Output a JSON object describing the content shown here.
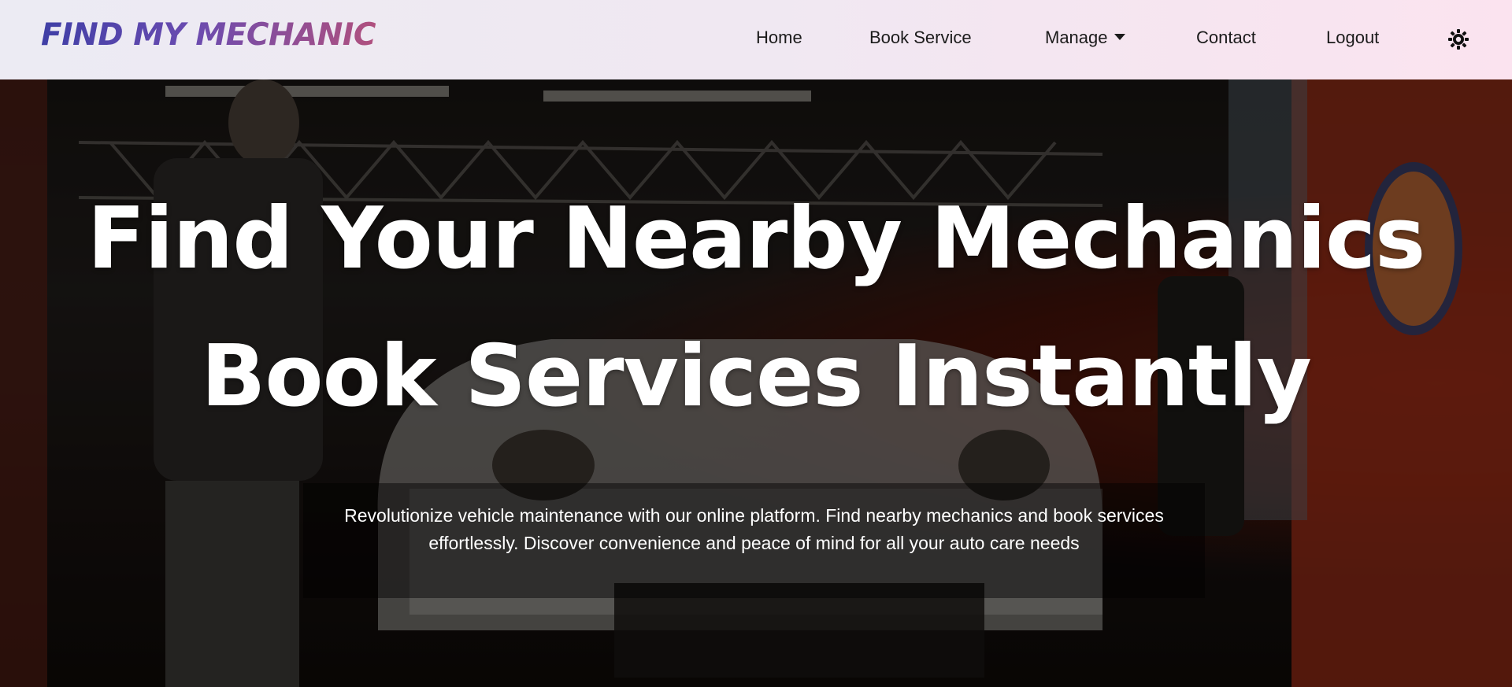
{
  "brand": {
    "logo_text": "FIND MY MECHANIC"
  },
  "nav": {
    "items": [
      {
        "label": "Home"
      },
      {
        "label": "Book Service"
      },
      {
        "label": "Manage",
        "has_dropdown": true
      },
      {
        "label": "Contact"
      },
      {
        "label": "Logout"
      }
    ],
    "theme_toggle_icon": "sun-icon"
  },
  "hero": {
    "headline_line1": "Find Your Nearby Mechanics",
    "headline_line2": "Book Services Instantly",
    "description": "Revolutionize vehicle maintenance with our online platform. Find nearby mechanics and book services effortlessly. Discover convenience and peace of mind for all your auto care needs",
    "background": "garage-photo-race-car"
  },
  "colors": {
    "logo_gradient_start": "#3f3fa6",
    "logo_gradient_end": "#b0507e",
    "nav_text": "#1b1b1b",
    "hero_text": "#ffffff"
  }
}
